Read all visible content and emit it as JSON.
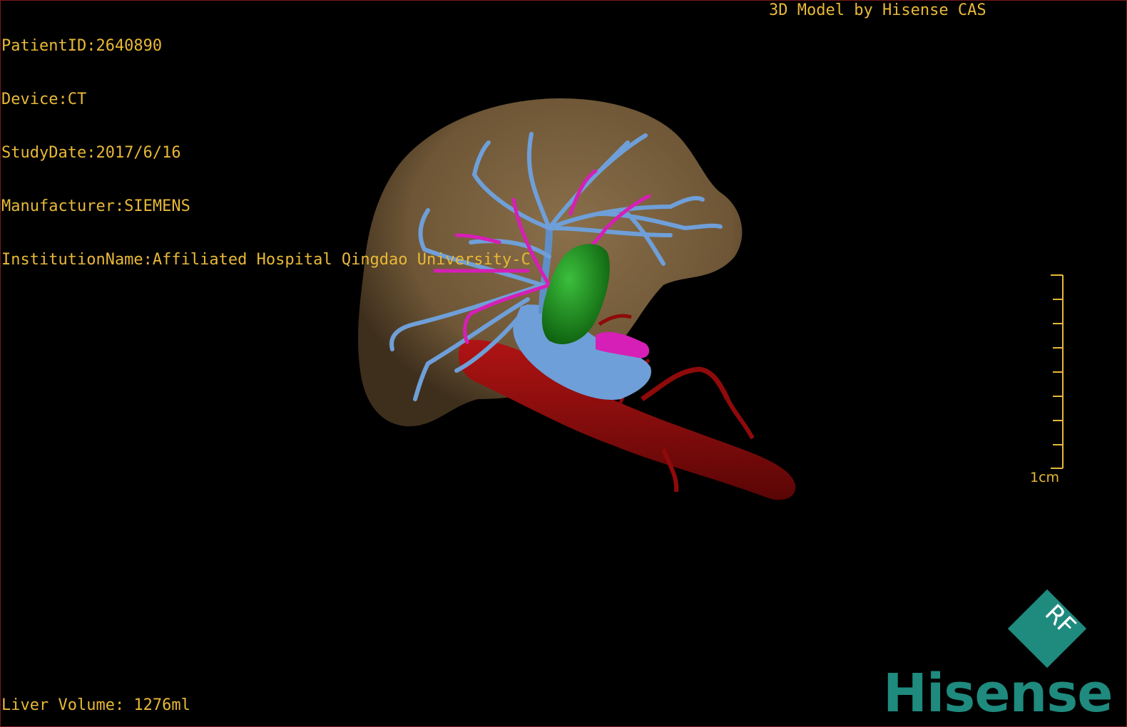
{
  "header": {
    "patient_id": "PatientID:2640890",
    "device": "Device:CT",
    "study_date": "StudyDate:2017/6/16",
    "manufacturer": "Manufacturer:SIEMENS",
    "institution": "InstitutionName:Affiliated Hospital Qingdao University-C",
    "model_title": "3D Model by Hisense CAS"
  },
  "footer": {
    "liver_volume": "Liver Volume: 1276ml"
  },
  "scale_bar": {
    "label": "1cm",
    "color": "#e8b838"
  },
  "logo": {
    "badge_text": "RF",
    "brand_text": "Hisense",
    "color": "#1f8a7e"
  },
  "colors": {
    "text": "#e8b838",
    "liver": "#7a6240",
    "portal_vein": "#6f9fd8",
    "hepatic_artery": "#d61fb6",
    "aorta": "#8f0a0a",
    "gallbladder": "#1c8c1c"
  }
}
